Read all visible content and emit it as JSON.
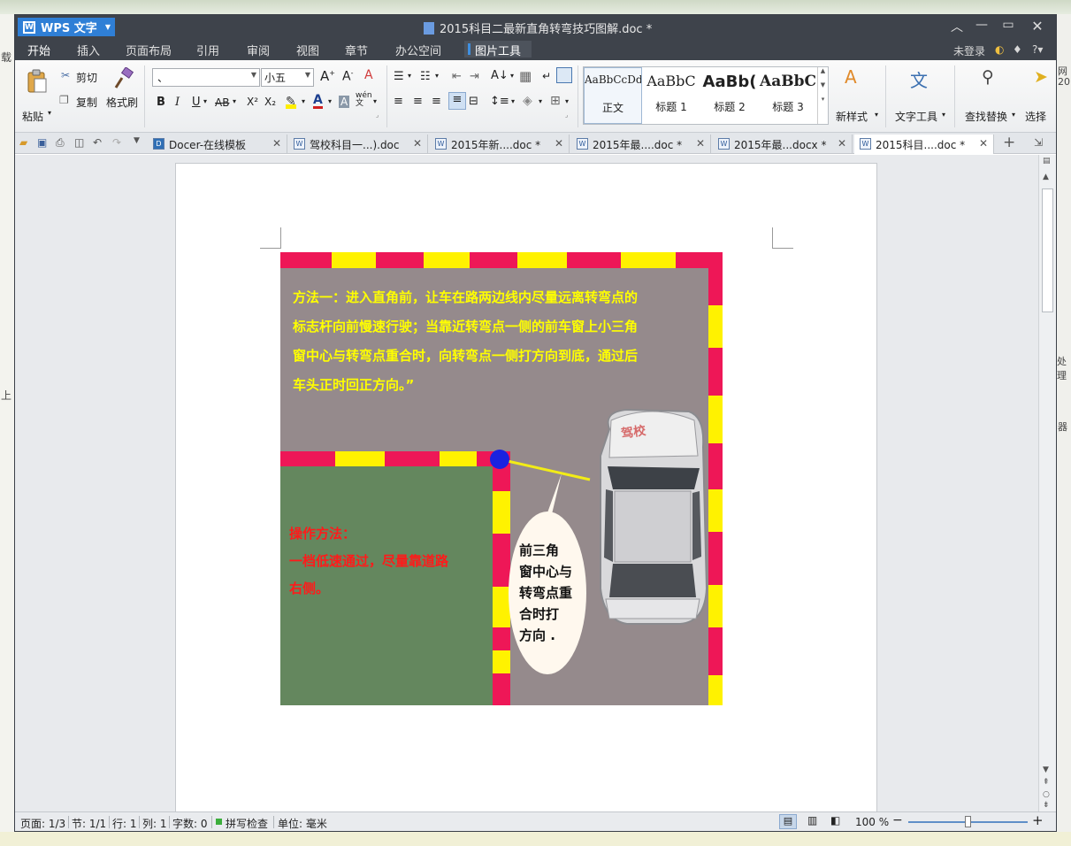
{
  "desktop": {
    "left_frag_1": "载",
    "left_frag_2": "上",
    "right_frag_1": "网",
    "right_frag_2": "20",
    "right_frag_3": "处理",
    "right_frag_4": "器"
  },
  "app": {
    "brand": "WPS 文字",
    "doc_title": "2015科目二最新直角转弯技巧图解.doc *",
    "menu_tabs": [
      "开始",
      "插入",
      "页面布局",
      "引用",
      "审阅",
      "视图",
      "章节",
      "办公空间"
    ],
    "picture_tools": "图片工具",
    "login": "未登录",
    "help": "?"
  },
  "ribbon": {
    "paste": "粘贴",
    "cut": "剪切",
    "copy": "复制",
    "format_painter": "格式刷",
    "font_name": "、",
    "font_size": "小五",
    "bold": "B",
    "italic": "I",
    "underline": "U",
    "strike": "AB",
    "superscript": "X²",
    "subscript": "X₂",
    "styles": [
      {
        "preview": "AaBbCcDd",
        "label": "正文"
      },
      {
        "preview": "AaBbC",
        "label": "标题 1"
      },
      {
        "preview": "AaBb(",
        "label": "标题 2"
      },
      {
        "preview": "AaBbC",
        "label": "标题 3"
      }
    ],
    "new_style": "新样式",
    "text_tools": "文字工具",
    "find_replace": "查找替换",
    "select": "选择"
  },
  "doc_tabs": [
    {
      "label": "Docer-在线模板",
      "icon": "D"
    },
    {
      "label": "驾校科目一...).doc",
      "icon": "W"
    },
    {
      "label": "2015年新....doc *",
      "icon": "W"
    },
    {
      "label": "2015年最....doc *",
      "icon": "W"
    },
    {
      "label": "2015年最...docx *",
      "icon": "W"
    },
    {
      "label": "2015科目....doc *",
      "icon": "W"
    }
  ],
  "document": {
    "method_text": [
      "方法一：进入直角前，让车在路两边线内尽量远离转弯点的",
      "标志杆向前慢速行驶；当靠近转弯点一侧的前车窗上小三角",
      "窗中心与转弯点重合时，向转弯点一侧打方向到底，通过后",
      "车头正时回正方向。”"
    ],
    "operation_text": [
      "操作方法：",
      "一档低速通过，尽量靠道路",
      "右侧。"
    ],
    "bubble_text": [
      "前三角",
      "窗中心与",
      "转弯点重",
      "合时打",
      "方向 ."
    ],
    "car_roof_text": "驾校"
  },
  "status": {
    "page": "页面: 1/3",
    "section": "节: 1/1",
    "row": "行: 1",
    "col": "列: 1",
    "words": "字数: 0",
    "spell": "拼写检查",
    "unit": "单位: 毫米",
    "zoom": "100 %",
    "zoom_level": 0.5
  },
  "colors": {
    "accent": "#2f7fd6",
    "titlebar": "#3e434b",
    "stripe_red": "#ee1757",
    "stripe_yellow": "#fff200",
    "road_gray": "#958a8c",
    "grass_green": "#64875e",
    "text_yellow": "#ffff00",
    "text_red": "#ff1a1a"
  }
}
